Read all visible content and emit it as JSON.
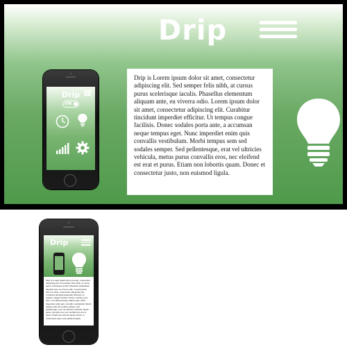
{
  "brand": {
    "logo": "Drip",
    "accent": "#6aa964",
    "accent_dark": "#4f9a4b"
  },
  "header": {
    "menu_icon": "hamburger-menu-icon"
  },
  "main": {
    "body_text": "Drip is Lorem ipsum dolor sit amet, consectetur adipiscing elit. Sed semper felis nibh, at cursus purus scelerisque iaculis. Phasellus elementum aliquam ante, eu viverra odio. Lorem ipsum dolor sit amet, consectetur adipiscing elit. Curabitur tincidunt imperdiet efficitur. Ut tempus congue facilisis. Donec sodales porta ante, a accumsan neque tempus eget. Nunc imperdiet enim quis convallis vestibulum. Morbi tempus sem sed sodales semper. Sed pellentesque, erat vel ultricies vehicula, metus purus convallis eros, nec eleifend est erat et purus. Etiam non lobortis quam. Donec et consectetur justo, non euismod ligula.",
    "hero_icon": "lightbulb-icon"
  },
  "phone_app": {
    "logo": "Drip",
    "toggle_label": "ON",
    "icons": [
      "clock-icon",
      "lightbulb-icon",
      "signal-bars-icon",
      "gear-icon"
    ]
  },
  "mobile_view": {
    "logo": "Drip",
    "body_text": "Drip is Lorem ipsum dolor sit amet, consectetur adipiscing elit. Sed semper felis nibh, at cursus purus scelerisque iaculis. Phasellus elementum aliquam ante, eu viverra odio. Lorem ipsum dolor sit amet, consectetur adipiscing elit. Curabitur tincidunt imperdiet efficitur. Ut tempus congue facilisis. Donec sodales porta ante, a accumsan neque tempus eget. Nunc imperdiet enim quis convallis vestibulum. Morbi tempus sem sed sodales semper. Sed pellentesque, erat vel ultricies vehicula, metus purus convallis eros, nec eleifend est erat et purus. Etiam non lobortis quam. Donec et consectetur justo, non euismod ligula."
  }
}
